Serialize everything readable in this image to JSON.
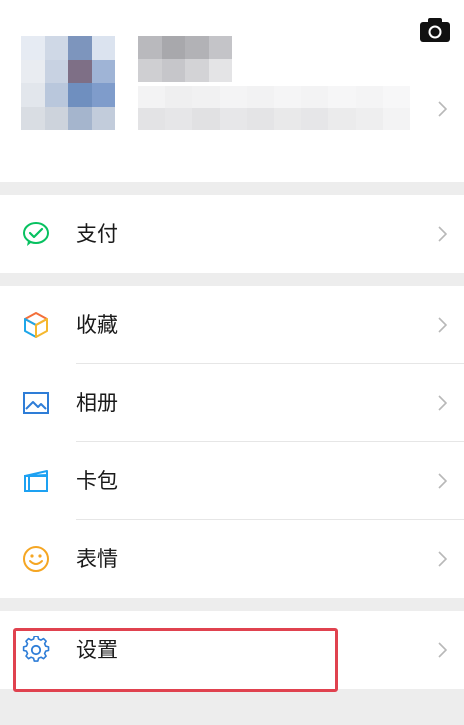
{
  "profile": {
    "camera_icon": "camera-icon",
    "avatar_blurred": true,
    "name_blurred": true,
    "id_blurred": true,
    "chevron_icon": "chevron-right-icon"
  },
  "menu": {
    "pay": {
      "label": "支付",
      "icon": "wechat-pay-icon",
      "color": "#07c160"
    },
    "favorites": {
      "label": "收藏",
      "icon": "cube-icon"
    },
    "album": {
      "label": "相册",
      "icon": "picture-icon",
      "color": "#2e7dd7"
    },
    "cards": {
      "label": "卡包",
      "icon": "card-wallet-icon",
      "color": "#1da1f2"
    },
    "stickers": {
      "label": "表情",
      "icon": "smiley-icon",
      "color": "#f5a623"
    },
    "settings": {
      "label": "设置",
      "icon": "gear-icon",
      "color": "#2e7dd7",
      "highlighted": true
    }
  },
  "colors": {
    "background": "#ededed",
    "highlight_border": "#e0424f"
  }
}
